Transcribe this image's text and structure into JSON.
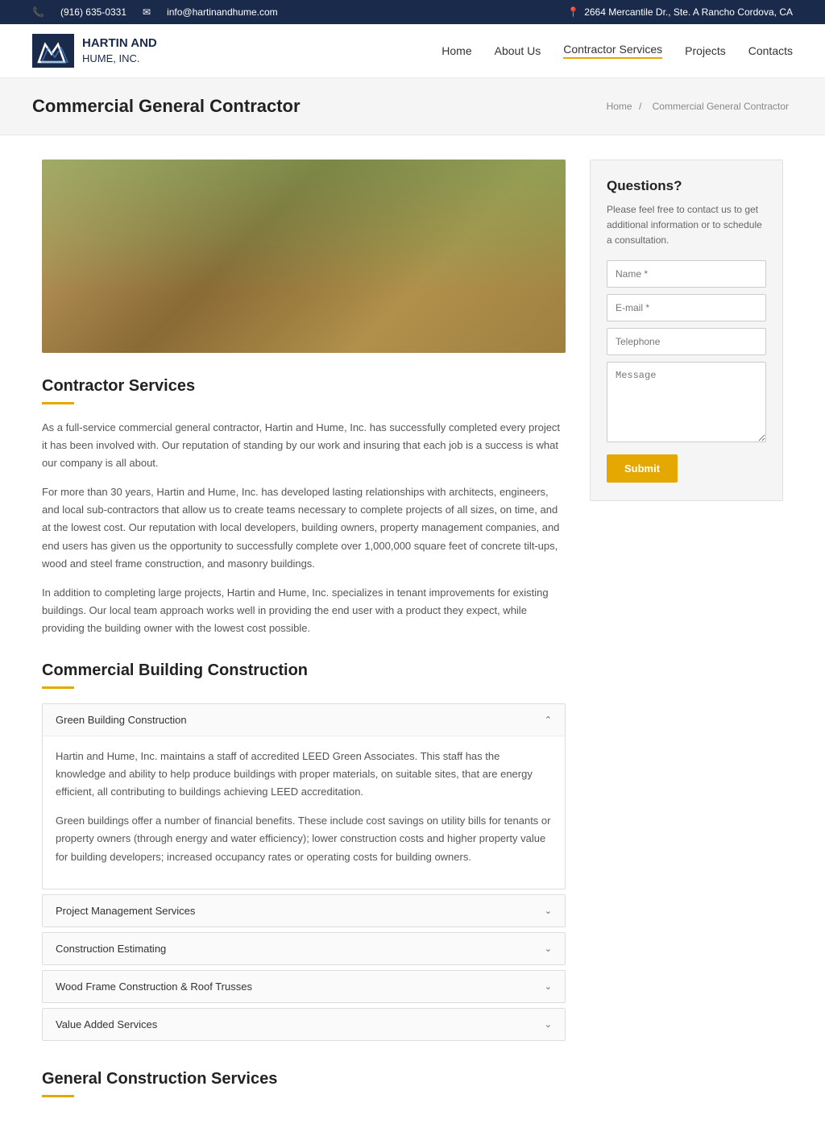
{
  "topbar": {
    "phone": "(916) 635-0331",
    "email": "info@hartinandhume.com",
    "address": "2664 Mercantile Dr., Ste. A Rancho Cordova, CA"
  },
  "header": {
    "logo_line1": "HARTIN AND",
    "logo_line2": "HUME, INC.",
    "nav": [
      {
        "label": "Home",
        "active": false
      },
      {
        "label": "About Us",
        "active": false
      },
      {
        "label": "Contractor Services",
        "active": true
      },
      {
        "label": "Projects",
        "active": false
      },
      {
        "label": "Contacts",
        "active": false
      }
    ]
  },
  "page": {
    "title": "Commercial General Contractor",
    "breadcrumb_home": "Home",
    "breadcrumb_current": "Commercial General Contractor"
  },
  "main": {
    "section1_title": "Contractor Services",
    "para1": "As a full-service commercial general contractor, Hartin and Hume, Inc. has successfully completed every project it has been involved with. Our reputation of standing by our work and insuring that each job is a success is what our company is all about.",
    "para2": "For more than 30 years, Hartin and Hume, Inc. has developed lasting relationships with architects, engineers, and local sub-contractors that allow us to create teams necessary to complete projects of all sizes, on time, and at the lowest cost. Our reputation with local developers, building owners, property management companies, and end users has given us the opportunity to successfully complete over 1,000,000 square feet of concrete tilt-ups, wood and steel frame construction, and masonry buildings.",
    "para3": "In addition to completing large projects, Hartin and Hume, Inc. specializes in tenant improvements for existing buildings. Our local team approach works well in providing the end user with a product they expect, while providing the building owner with the lowest cost possible.",
    "section2_title": "Commercial Building Construction",
    "accordion": [
      {
        "label": "Green Building Construction",
        "open": true,
        "content": "Hartin and Hume, Inc. maintains a staff of accredited LEED Green Associates. This staff has the knowledge and ability to help produce buildings with proper materials, on suitable sites, that are energy efficient, all contributing to buildings achieving LEED accreditation.\n\nGreen buildings offer a number of financial benefits. These include cost savings on utility bills for tenants or property owners (through energy and water efficiency); lower construction costs and higher property value for building developers; increased occupancy rates or operating costs for building owners."
      },
      {
        "label": "Project Management Services",
        "open": false,
        "content": ""
      },
      {
        "label": "Construction Estimating",
        "open": false,
        "content": ""
      },
      {
        "label": "Wood Frame Construction & Roof Trusses",
        "open": false,
        "content": ""
      },
      {
        "label": "Value Added Services",
        "open": false,
        "content": ""
      }
    ],
    "section3_title": "General Construction Services"
  },
  "sidebar": {
    "title": "Questions?",
    "description": "Please feel free to contact us to get additional information or to schedule a consultation.",
    "form": {
      "name_placeholder": "Name *",
      "email_placeholder": "E-mail *",
      "telephone_placeholder": "Telephone",
      "message_placeholder": "Message",
      "submit_label": "Submit"
    }
  }
}
